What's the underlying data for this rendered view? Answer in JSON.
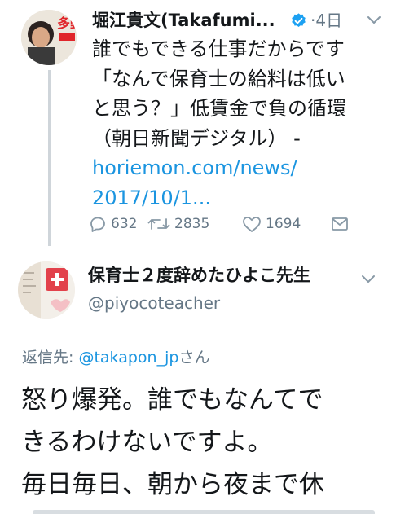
{
  "tweet": {
    "display_name": "堀江貴文(Takafumi...",
    "time": "·4日",
    "text_lines": [
      "誰でもできる仕事だからです",
      "「なんで保育士の給料は低い",
      "と思う？」低賃金で負の循環",
      "（朝日新聞デジタル） -"
    ],
    "link_lines": [
      "horiemon.com/news/",
      "2017/10/1..."
    ],
    "avatar_text": "多動力",
    "actions": {
      "replies": "632",
      "retweets": "2835",
      "likes": "1694"
    }
  },
  "reply": {
    "display_name": "保育士２度辞めたひよこ先生",
    "handle": "@piyocoteacher",
    "reply_to_label": "返信先: ",
    "reply_to_mention": "@takapon_jp",
    "reply_to_suffix": "さん",
    "text_lines": [
      "怒り爆発。誰でもなんてで",
      "きるわけないですよ。",
      "毎日毎日、朝から夜まで休"
    ]
  },
  "colors": {
    "link": "#1b95e0",
    "secondary_text": "#657786",
    "verified": "#1da1f2"
  }
}
